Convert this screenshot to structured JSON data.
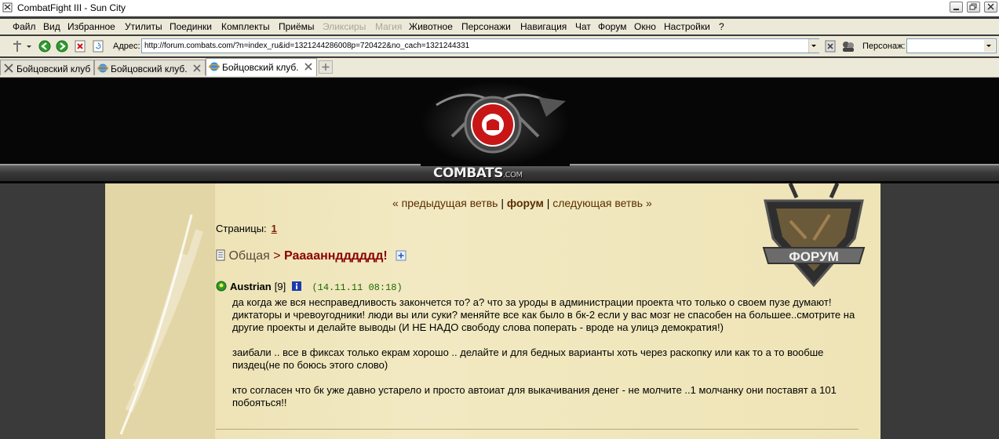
{
  "window": {
    "title": "CombatFight III - Sun City"
  },
  "menu": {
    "items": [
      "Файл",
      "Вид",
      "Избранное",
      "Утилиты",
      "Поединки",
      "Комплекты",
      "Приёмы",
      "Эликсиры",
      "Магия",
      "Животное",
      "Персонажи",
      "Навигация",
      "Чат",
      "Форум",
      "Окно",
      "Настройки",
      "?"
    ],
    "disabled": [
      "Эликсиры",
      "Магия"
    ]
  },
  "toolbar": {
    "address_label": "Адрес:",
    "address_value": "http://forum.combats.com/?n=index_ru&id=1321244286008p=720422&no_cach=1321244331",
    "character_label": "Персонаж:",
    "character_value": ""
  },
  "tabs": [
    {
      "label": "Бойцовский клуб",
      "icon": "crossed-swords-icon"
    },
    {
      "label": "Бойцовский клуб.",
      "icon": "ie-globe-icon"
    },
    {
      "label": "Бойцовский клуб.",
      "icon": "ie-globe-icon",
      "active": true
    }
  ],
  "banner": {
    "logo_text": "COMBATS",
    "logo_suffix": ".COM"
  },
  "forum": {
    "nav": {
      "prev": "« предыдущая ветвь",
      "sep1": " | ",
      "forum": "форум",
      "sep2": " | ",
      "next": "следующая ветвь »"
    },
    "pages_label": "Страницы:",
    "pages": [
      "1"
    ],
    "category": "Общая",
    "arrow": " > ",
    "topic": "Раааанндддддд!",
    "badge_text": "ФОРУМ"
  },
  "post": {
    "author": "Austrian",
    "level": "[9]",
    "date": "(14.11.11 08:18)",
    "paragraphs": [
      "да когда же вся несправедливость закончется то? а? что за уроды в администрации проекта что только о своем пузе думают! диктаторы и чревоугодники! люди вы или суки? меняйте все как было в бк-2 если у вас мозг не спасобен на большее..смотрите на другие проекты и делайте выводы (И НЕ НАДО свободу слова поперать - вроде на улицэ демократия!)",
      "заибали .. все в фиксах только екрам хорошо .. делайте и для бедных варианты хоть через раскопку или как то а то вообше пиздец(не по боюсь этого слово)",
      "кто согласен что бк уже давно устарело и просто автоиат для выкачивания денег - не молчите ..1 молчанку они поставят а 101 побояться!!"
    ]
  },
  "colors": {
    "menu_bg": "#ece9d8",
    "banner_bg": "#060606",
    "parchment": "#f2e9c2",
    "topic": "#8a0000",
    "link": "#5a2d00",
    "date": "#1a6a00"
  }
}
